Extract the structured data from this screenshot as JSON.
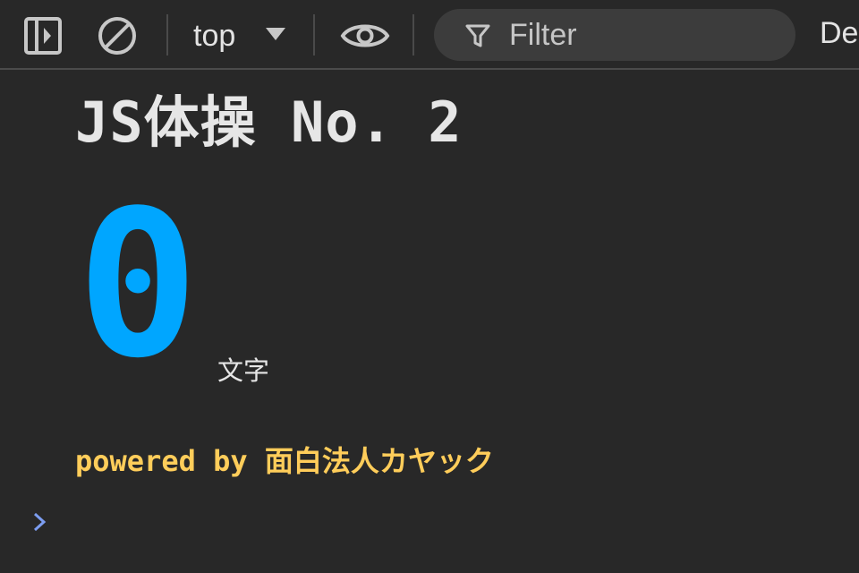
{
  "toolbar": {
    "context": "top",
    "filter_placeholder": "Filter",
    "levels_label": "De"
  },
  "console": {
    "title": "JS体操 No. 2",
    "count": "0",
    "unit": "文字",
    "powered_by": "powered by 面白法人カヤック"
  },
  "icons": {
    "sidebar_toggle": "sidebar-toggle-icon",
    "clear": "clear-console-icon",
    "context_dropdown": "triangle-down-icon",
    "live_expression": "eye-icon",
    "filter": "filter-funnel-icon",
    "prompt": "chevron-right-icon"
  },
  "colors": {
    "background": "#282828",
    "count": "#00a6ff",
    "powered_by": "#ffcd5a",
    "prompt": "#7c9df0",
    "filter_box": "#3c3c3c"
  }
}
